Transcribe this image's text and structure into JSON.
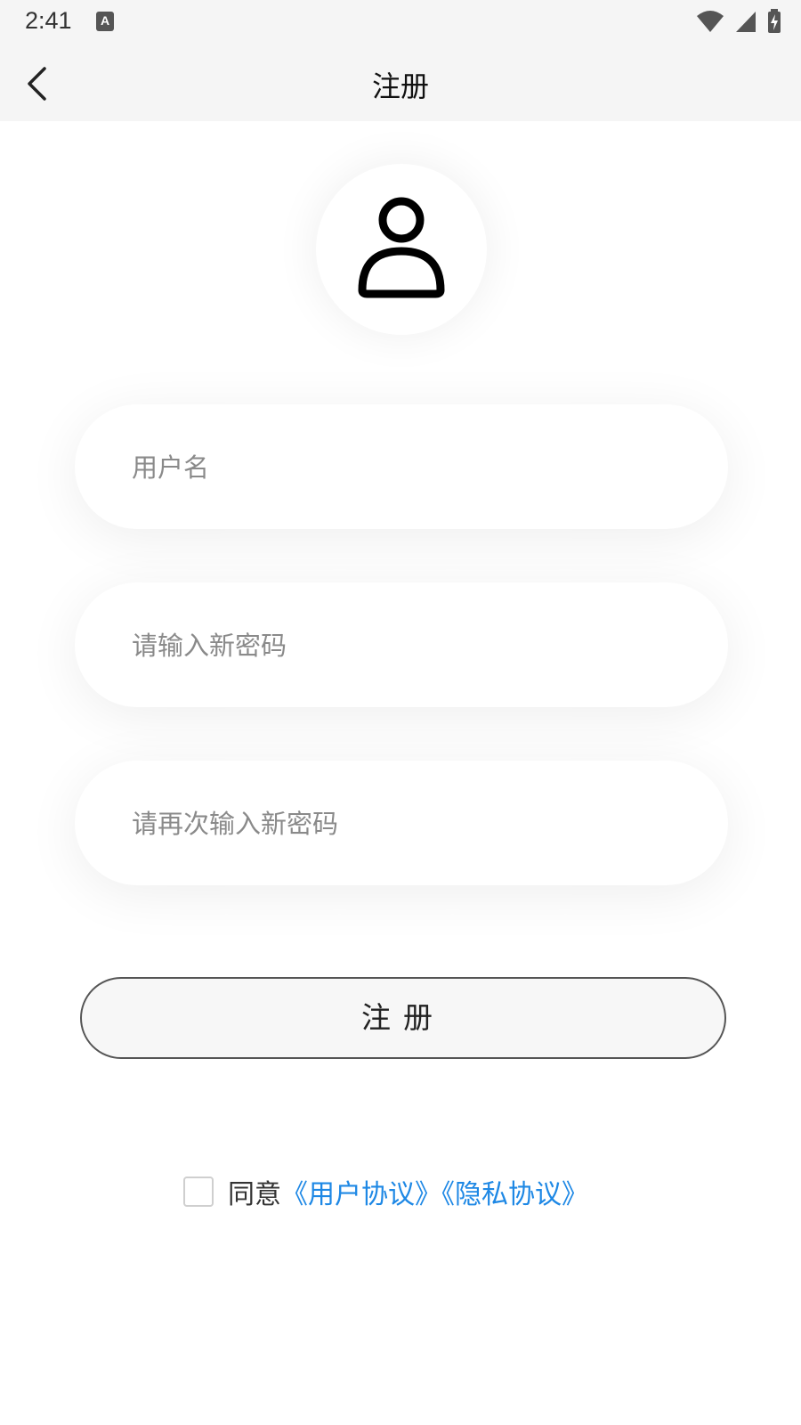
{
  "status_bar": {
    "time": "2:41",
    "keyboard_indicator": "A",
    "icons": [
      "wifi-icon",
      "cell-signal-icon",
      "battery-charging-icon"
    ]
  },
  "header": {
    "title": "注册",
    "back_icon": "chevron-left-icon"
  },
  "avatar": {
    "icon": "user-icon"
  },
  "form": {
    "username_placeholder": "用户名",
    "password_placeholder": "请输入新密码",
    "confirm_password_placeholder": "请再次输入新密码",
    "submit_label": "注册"
  },
  "agreement": {
    "prefix": "同意",
    "user_agreement_link": "《用户协议》",
    "privacy_agreement_link": "《隐私协议》",
    "checked": false
  },
  "colors": {
    "link": "#1e88e5",
    "header_bg": "#f5f5f5"
  }
}
